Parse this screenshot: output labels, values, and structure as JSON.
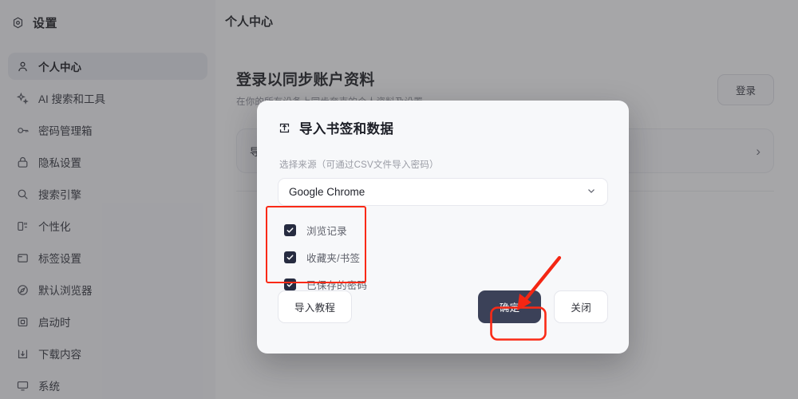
{
  "sidebar": {
    "brand": "设置",
    "brand_icon": "settings-hex-icon",
    "items": [
      {
        "label": "个人中心",
        "icon": "person-icon",
        "active": true
      },
      {
        "label": "AI 搜索和工具",
        "icon": "sparkle-icon",
        "active": false
      },
      {
        "label": "密码管理箱",
        "icon": "key-icon",
        "active": false
      },
      {
        "label": "隐私设置",
        "icon": "lock-icon",
        "active": false
      },
      {
        "label": "搜索引擎",
        "icon": "search-icon",
        "active": false
      },
      {
        "label": "个性化",
        "icon": "personalize-icon",
        "active": false
      },
      {
        "label": "标签设置",
        "icon": "tab-icon",
        "active": false
      },
      {
        "label": "默认浏览器",
        "icon": "compass-icon",
        "active": false
      },
      {
        "label": "启动时",
        "icon": "startup-icon",
        "active": false
      },
      {
        "label": "下载内容",
        "icon": "download-icon",
        "active": false
      },
      {
        "label": "系统",
        "icon": "monitor-icon",
        "active": false
      }
    ]
  },
  "main": {
    "page_title": "个人中心",
    "sync": {
      "heading": "登录以同步账户资料",
      "subtitle": "在你的所有设备上同步夸克的个人资料及设置",
      "login_label": "登录"
    },
    "import_row": {
      "label": "导入书签和数据",
      "chevron": "chevron-right-icon"
    }
  },
  "modal": {
    "title": "导入书签和数据",
    "title_icon": "import-box-icon",
    "field_label": "选择来源（可通过CSV文件导入密码）",
    "source_select": {
      "value": "Google Chrome",
      "chevron": "chevron-down-icon",
      "options": [
        "Google Chrome"
      ]
    },
    "checkboxes": [
      {
        "label": "浏览记录",
        "checked": true
      },
      {
        "label": "收藏夹/书签",
        "checked": true
      },
      {
        "label": "已保存的密码",
        "checked": true
      }
    ],
    "buttons": {
      "tutorial": "导入教程",
      "confirm": "确定",
      "close": "关闭"
    }
  },
  "annotations": {
    "highlight_color": "#fa2a16",
    "arrow_color": "#f42613",
    "checkbox_group_box": true,
    "confirm_button_box": true,
    "arrow_points_to": "确定"
  },
  "colors": {
    "accent_dark": "#3b4158",
    "checkbox_fill": "#262b40",
    "sidebar_bg": "#f7f7f9",
    "modal_bg": "#f7f8fa",
    "annotation_red": "#fa2a16"
  }
}
